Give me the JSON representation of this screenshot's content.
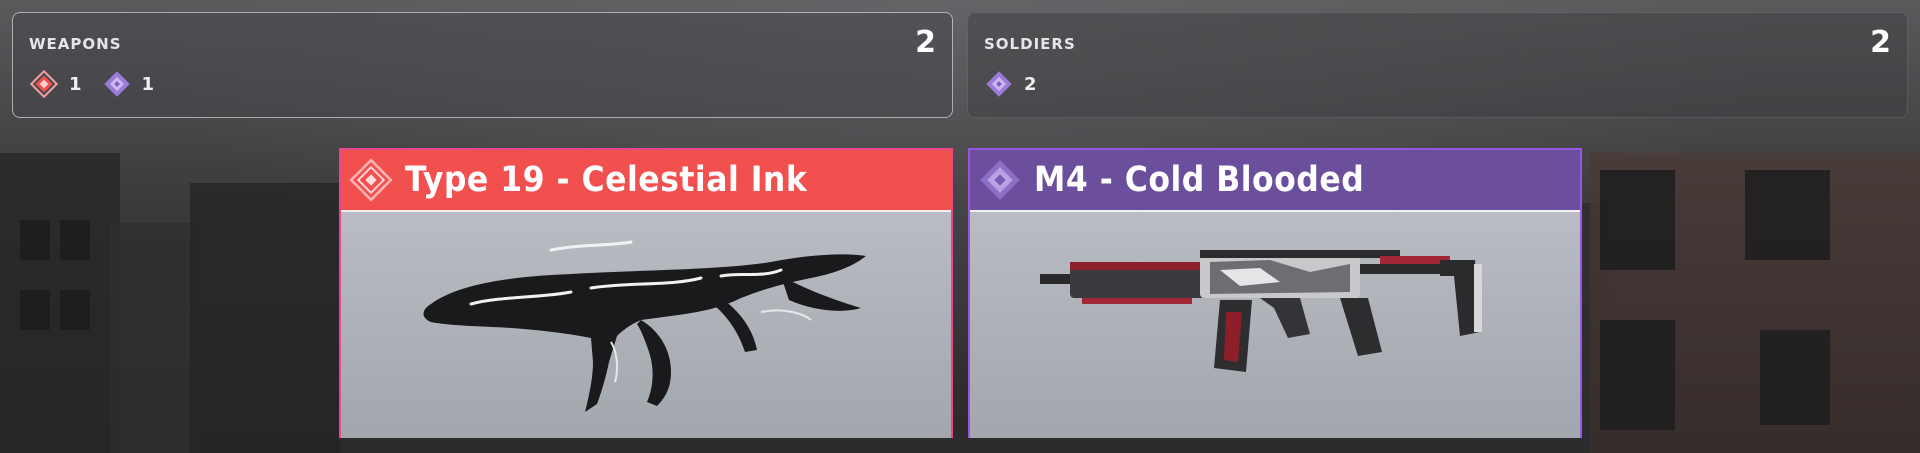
{
  "summary": {
    "weapons": {
      "label": "WEAPONS",
      "total": "2",
      "chips": [
        {
          "icon": "rarity-red-diamond-icon",
          "color": "#f24f4f",
          "count": "1"
        },
        {
          "icon": "rarity-purple-diamond-icon",
          "color": "#9b7bd8",
          "count": "1"
        }
      ]
    },
    "soldiers": {
      "label": "SOLDIERS",
      "total": "2",
      "chips": [
        {
          "icon": "rarity-purple-diamond-icon",
          "color": "#9b7bd8",
          "count": "2"
        }
      ]
    }
  },
  "items": [
    {
      "name": "Type 19 - Celestial Ink",
      "rarity_color": "#f24f4f",
      "border_color": "#e8468f",
      "icon": "rarity-red-diamond-icon",
      "image": "type19-celestial-ink-weapon-image"
    },
    {
      "name": "M4 - Cold Blooded",
      "rarity_color": "#6b4f9c",
      "border_color": "#9a55e0",
      "icon": "rarity-purple-diamond-icon",
      "image": "m4-cold-blooded-weapon-image"
    }
  ]
}
